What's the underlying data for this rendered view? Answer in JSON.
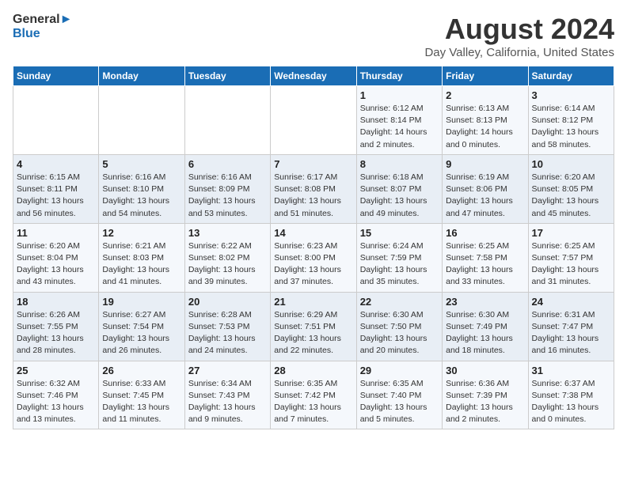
{
  "header": {
    "logo_line1": "General",
    "logo_line2": "Blue",
    "title": "August 2024",
    "subtitle": "Day Valley, California, United States"
  },
  "days_of_week": [
    "Sunday",
    "Monday",
    "Tuesday",
    "Wednesday",
    "Thursday",
    "Friday",
    "Saturday"
  ],
  "weeks": [
    [
      {
        "day": "",
        "info": ""
      },
      {
        "day": "",
        "info": ""
      },
      {
        "day": "",
        "info": ""
      },
      {
        "day": "",
        "info": ""
      },
      {
        "day": "1",
        "info": "Sunrise: 6:12 AM\nSunset: 8:14 PM\nDaylight: 14 hours\nand 2 minutes."
      },
      {
        "day": "2",
        "info": "Sunrise: 6:13 AM\nSunset: 8:13 PM\nDaylight: 14 hours\nand 0 minutes."
      },
      {
        "day": "3",
        "info": "Sunrise: 6:14 AM\nSunset: 8:12 PM\nDaylight: 13 hours\nand 58 minutes."
      }
    ],
    [
      {
        "day": "4",
        "info": "Sunrise: 6:15 AM\nSunset: 8:11 PM\nDaylight: 13 hours\nand 56 minutes."
      },
      {
        "day": "5",
        "info": "Sunrise: 6:16 AM\nSunset: 8:10 PM\nDaylight: 13 hours\nand 54 minutes."
      },
      {
        "day": "6",
        "info": "Sunrise: 6:16 AM\nSunset: 8:09 PM\nDaylight: 13 hours\nand 53 minutes."
      },
      {
        "day": "7",
        "info": "Sunrise: 6:17 AM\nSunset: 8:08 PM\nDaylight: 13 hours\nand 51 minutes."
      },
      {
        "day": "8",
        "info": "Sunrise: 6:18 AM\nSunset: 8:07 PM\nDaylight: 13 hours\nand 49 minutes."
      },
      {
        "day": "9",
        "info": "Sunrise: 6:19 AM\nSunset: 8:06 PM\nDaylight: 13 hours\nand 47 minutes."
      },
      {
        "day": "10",
        "info": "Sunrise: 6:20 AM\nSunset: 8:05 PM\nDaylight: 13 hours\nand 45 minutes."
      }
    ],
    [
      {
        "day": "11",
        "info": "Sunrise: 6:20 AM\nSunset: 8:04 PM\nDaylight: 13 hours\nand 43 minutes."
      },
      {
        "day": "12",
        "info": "Sunrise: 6:21 AM\nSunset: 8:03 PM\nDaylight: 13 hours\nand 41 minutes."
      },
      {
        "day": "13",
        "info": "Sunrise: 6:22 AM\nSunset: 8:02 PM\nDaylight: 13 hours\nand 39 minutes."
      },
      {
        "day": "14",
        "info": "Sunrise: 6:23 AM\nSunset: 8:00 PM\nDaylight: 13 hours\nand 37 minutes."
      },
      {
        "day": "15",
        "info": "Sunrise: 6:24 AM\nSunset: 7:59 PM\nDaylight: 13 hours\nand 35 minutes."
      },
      {
        "day": "16",
        "info": "Sunrise: 6:25 AM\nSunset: 7:58 PM\nDaylight: 13 hours\nand 33 minutes."
      },
      {
        "day": "17",
        "info": "Sunrise: 6:25 AM\nSunset: 7:57 PM\nDaylight: 13 hours\nand 31 minutes."
      }
    ],
    [
      {
        "day": "18",
        "info": "Sunrise: 6:26 AM\nSunset: 7:55 PM\nDaylight: 13 hours\nand 28 minutes."
      },
      {
        "day": "19",
        "info": "Sunrise: 6:27 AM\nSunset: 7:54 PM\nDaylight: 13 hours\nand 26 minutes."
      },
      {
        "day": "20",
        "info": "Sunrise: 6:28 AM\nSunset: 7:53 PM\nDaylight: 13 hours\nand 24 minutes."
      },
      {
        "day": "21",
        "info": "Sunrise: 6:29 AM\nSunset: 7:51 PM\nDaylight: 13 hours\nand 22 minutes."
      },
      {
        "day": "22",
        "info": "Sunrise: 6:30 AM\nSunset: 7:50 PM\nDaylight: 13 hours\nand 20 minutes."
      },
      {
        "day": "23",
        "info": "Sunrise: 6:30 AM\nSunset: 7:49 PM\nDaylight: 13 hours\nand 18 minutes."
      },
      {
        "day": "24",
        "info": "Sunrise: 6:31 AM\nSunset: 7:47 PM\nDaylight: 13 hours\nand 16 minutes."
      }
    ],
    [
      {
        "day": "25",
        "info": "Sunrise: 6:32 AM\nSunset: 7:46 PM\nDaylight: 13 hours\nand 13 minutes."
      },
      {
        "day": "26",
        "info": "Sunrise: 6:33 AM\nSunset: 7:45 PM\nDaylight: 13 hours\nand 11 minutes."
      },
      {
        "day": "27",
        "info": "Sunrise: 6:34 AM\nSunset: 7:43 PM\nDaylight: 13 hours\nand 9 minutes."
      },
      {
        "day": "28",
        "info": "Sunrise: 6:35 AM\nSunset: 7:42 PM\nDaylight: 13 hours\nand 7 minutes."
      },
      {
        "day": "29",
        "info": "Sunrise: 6:35 AM\nSunset: 7:40 PM\nDaylight: 13 hours\nand 5 minutes."
      },
      {
        "day": "30",
        "info": "Sunrise: 6:36 AM\nSunset: 7:39 PM\nDaylight: 13 hours\nand 2 minutes."
      },
      {
        "day": "31",
        "info": "Sunrise: 6:37 AM\nSunset: 7:38 PM\nDaylight: 13 hours\nand 0 minutes."
      }
    ]
  ]
}
